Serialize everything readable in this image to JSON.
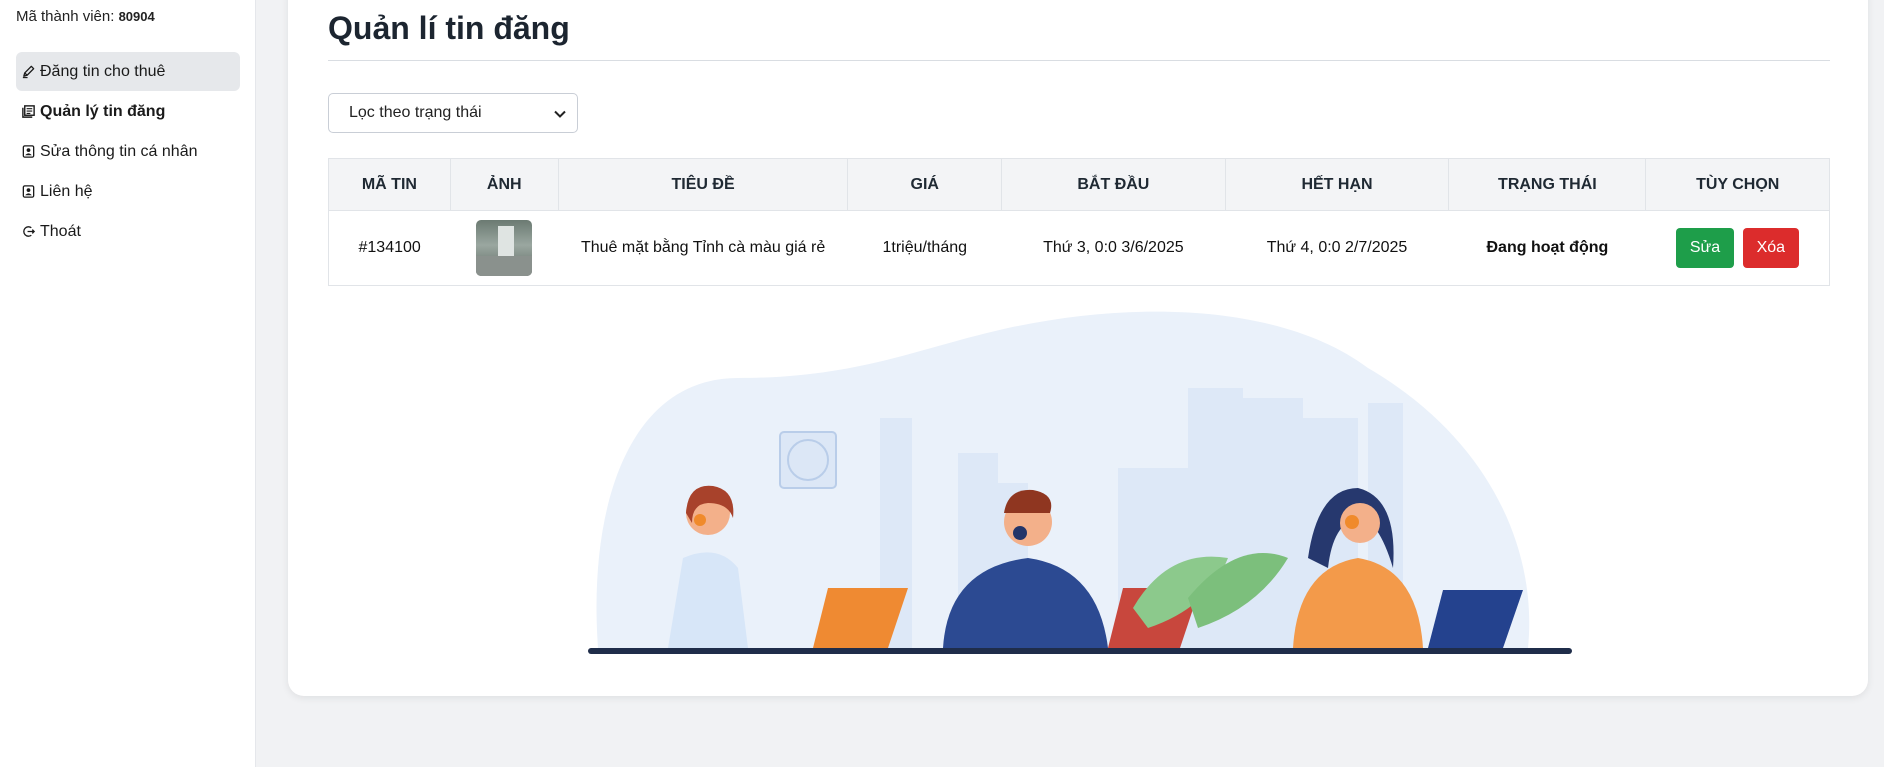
{
  "sidebar": {
    "member_label": "Mã thành viên:",
    "member_id": "80904",
    "items": [
      {
        "label": "Đăng tin cho thuê",
        "icon": "pen-icon"
      },
      {
        "label": "Quản lý tin đăng",
        "icon": "list-icon"
      },
      {
        "label": "Sửa thông tin cá nhân",
        "icon": "user-badge-icon"
      },
      {
        "label": "Liên hệ",
        "icon": "contact-icon"
      },
      {
        "label": "Thoát",
        "icon": "logout-icon"
      }
    ]
  },
  "main": {
    "title": "Quản lí tin đăng",
    "filter": {
      "selected": "Lọc theo trạng thái"
    },
    "table": {
      "headers": [
        "MÃ TIN",
        "ẢNH",
        "TIÊU ĐỀ",
        "GIÁ",
        "BẮT ĐẦU",
        "HẾT HẠN",
        "TRẠNG THÁI",
        "TÙY CHỌN"
      ],
      "rows": [
        {
          "id": "#134100",
          "title": "Thuê mặt bằng Tỉnh cà màu giá rẻ",
          "price": "1triệu/tháng",
          "start": "Thứ 3, 0:0 3/6/2025",
          "end": "Thứ 4, 0:0 2/7/2025",
          "status": "Đang hoạt động",
          "edit_label": "Sửa",
          "delete_label": "Xóa"
        }
      ]
    }
  },
  "colors": {
    "status_active": "#22a04b",
    "edit_button": "#1e9e4a",
    "delete_button": "#dc2c2c"
  }
}
